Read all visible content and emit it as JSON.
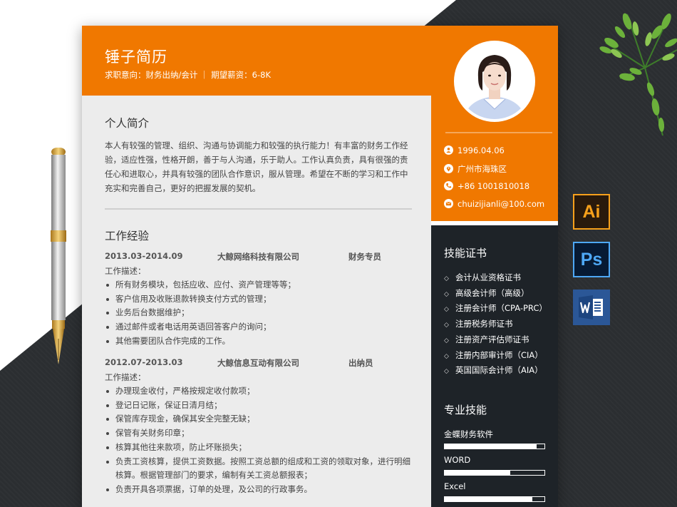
{
  "resume": {
    "name": "锤子简历",
    "subline": "求职意向：财务出纳/会计 ｜ 期望薪资：6-8K",
    "intro": {
      "title": "个人简介",
      "text": "本人有较强的管理、组织、沟通与协调能力和较强的执行能力！有丰富的财务工作经验，适应性强，性格开朗，善于与人沟通，乐于助人。工作认真负责，具有很强的责任心和进取心，并具有较强的团队合作意识，服从管理。希望在不断的学习和工作中充实和完善自己，更好的把握发展的契机。"
    },
    "work": {
      "title": "工作经验",
      "jobs": [
        {
          "period": "2013.03-2014.09",
          "company": "大鲸网络科技有限公司",
          "position": "财务专员",
          "desc_label": "工作描述：",
          "items": [
            "所有财务模块，包括应收、应付、资产管理等等；",
            "客户信用及收账退款转换支付方式的管理；",
            "业务后台数据维护；",
            "通过邮件或者电话用英语回答客户的询问；",
            "其他需要团队合作完成的工作。"
          ]
        },
        {
          "period": "2012.07-2013.03",
          "company": "大鲸信息互动有限公司",
          "position": "出纳员",
          "desc_label": "工作描述：",
          "items": [
            "办理现金收付，严格按规定收付款项；",
            "登记日记账，保证日清月结；",
            "保管库存现金，确保其安全完整无缺；",
            "保管有关财务印章；",
            "核算其他往来款项，防止坏账损失；",
            "负责工资核算，提供工资数据。按照工资总额的组成和工资的领取对象，进行明细核算。根据管理部门的要求，编制有关工资总额报表；",
            "负责开具各项票据，订单的处理，及公司的行政事务。"
          ]
        }
      ]
    },
    "contact": {
      "birth": "1996.04.06",
      "location": "广州市海珠区",
      "phone": "+86 1001810018",
      "email": "chuizijianli@100.com"
    },
    "certs": {
      "title": "技能证书",
      "items": [
        "会计从业资格证书",
        "高级会计师（高级）",
        "注册会计师（CPA-PRC）",
        "注册税务师证书",
        "注册资产评估师证书",
        "注册内部审计师（CIA）",
        "英国国际会计师（AIA）"
      ]
    },
    "skills": {
      "title": "专业技能",
      "items": [
        {
          "name": "金蝶财务软件",
          "level": 0.92
        },
        {
          "name": "WORD",
          "level": 0.66
        },
        {
          "name": "Excel",
          "level": 0.88
        }
      ]
    }
  },
  "apps": {
    "ai": "Ai",
    "ps": "Ps"
  },
  "colors": {
    "accent": "#f07800",
    "dark": "#1e2328"
  }
}
